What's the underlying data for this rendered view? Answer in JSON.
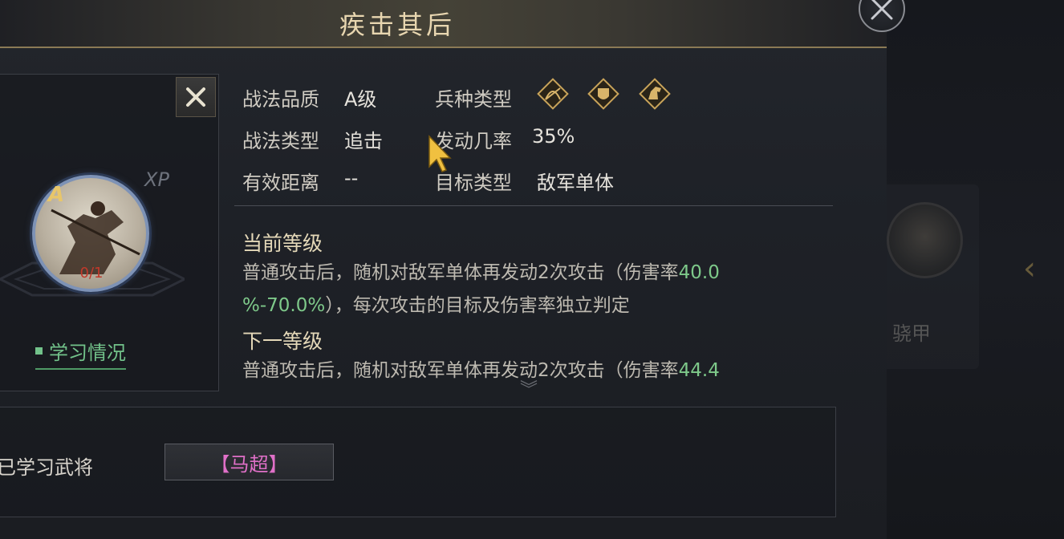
{
  "window": {
    "title": "疾击其后"
  },
  "skill_card": {
    "quality_badge": "A",
    "xp_label": "XP",
    "learn_count": "0/1",
    "learn_status_label": "学习情况"
  },
  "info": {
    "quality": {
      "label": "战法品质",
      "value": "A级"
    },
    "type": {
      "label": "战法类型",
      "value": "追击"
    },
    "range": {
      "label": "有效距离",
      "value": "--"
    },
    "troop_type": {
      "label": "兵种类型",
      "icons": [
        "archer-icon",
        "shield-icon",
        "cavalry-icon"
      ]
    },
    "trigger_rate": {
      "label": "发动几率",
      "value": "35%"
    },
    "target_type": {
      "label": "目标类型",
      "value": "敌军单体"
    }
  },
  "current_level": {
    "title": "当前等级",
    "line1_prefix": "普通攻击后，随机对敌军单体再发动2次攻击（伤害率",
    "line1_hl": "40.0",
    "line2_hl": "%-70.0%",
    "line2_suffix": "），每次攻击的目标及伤害率独立判定"
  },
  "next_level": {
    "title": "下一等级",
    "line1_prefix": "普通攻击后，随机对敌军单体再发动2次攻击（伤害率",
    "line1_hl": "44.4"
  },
  "learned": {
    "label": "已学习武将",
    "general": "【马超】"
  },
  "background": {
    "card_label": "骁甲"
  },
  "colors": {
    "accent_gold": "#e8d6b0",
    "highlight_green": "#7ec98a",
    "general_pink": "#e070c8",
    "portrait_ring": "#7d92b6"
  }
}
